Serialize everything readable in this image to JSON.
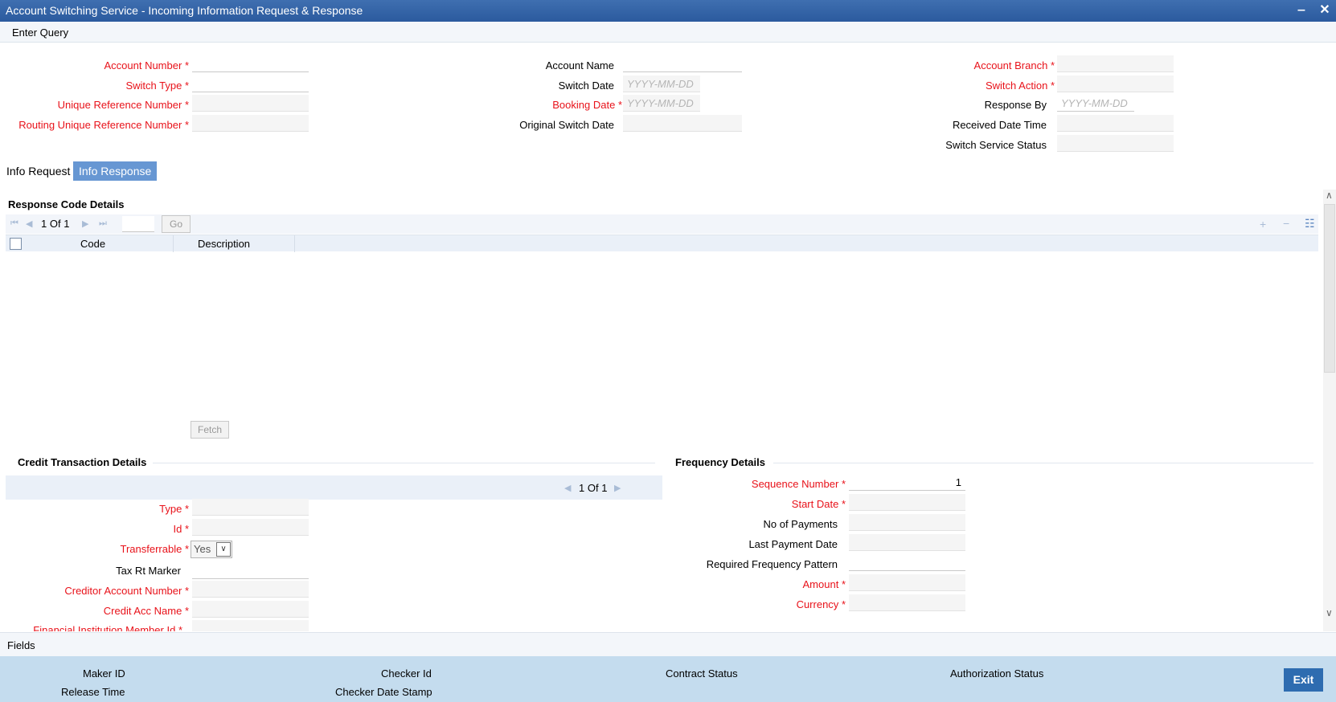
{
  "window": {
    "title": "Account Switching Service - Incoming Information Request & Response"
  },
  "menu": {
    "enter_query": "Enter Query"
  },
  "header_fields": {
    "account_number": {
      "label": "Account Number",
      "req": "*",
      "value": ""
    },
    "switch_type": {
      "label": "Switch Type",
      "req": "*",
      "value": ""
    },
    "unique_reference_number": {
      "label": "Unique Reference Number",
      "req": "*",
      "value": ""
    },
    "routing_unique_reference_number": {
      "label": "Routing Unique Reference Number",
      "req": "*",
      "value": ""
    },
    "account_name": {
      "label": "Account Name",
      "value": ""
    },
    "switch_date": {
      "label": "Switch Date",
      "placeholder": "YYYY-MM-DD"
    },
    "booking_date": {
      "label": "Booking Date",
      "req": "*",
      "placeholder": "YYYY-MM-DD"
    },
    "original_switch_date": {
      "label": "Original Switch Date",
      "value": ""
    },
    "account_branch": {
      "label": "Account Branch",
      "req": "*",
      "value": ""
    },
    "switch_action": {
      "label": "Switch Action",
      "req": "*",
      "value": ""
    },
    "response_by": {
      "label": "Response By",
      "placeholder": "YYYY-MM-DD"
    },
    "received_date_time": {
      "label": "Received Date Time",
      "value": ""
    },
    "switch_service_status": {
      "label": "Switch Service Status",
      "value": ""
    }
  },
  "tabs": [
    {
      "label": "Info Request",
      "active": false
    },
    {
      "label": "Info Response",
      "active": true
    }
  ],
  "response_code": {
    "title": "Response Code Details",
    "pager": {
      "current": "1",
      "of_label": "Of",
      "total": "1"
    },
    "go_label": "Go",
    "columns": {
      "code": "Code",
      "description": "Description"
    },
    "fetch_label": "Fetch"
  },
  "credit_transaction": {
    "title": "Credit Transaction Details",
    "pager": {
      "current": "1",
      "of_label": "Of",
      "total": "1"
    },
    "type": {
      "label": "Type",
      "req": "*",
      "value": ""
    },
    "id": {
      "label": "Id",
      "req": "*",
      "value": ""
    },
    "transferrable": {
      "label": "Transferrable",
      "req": "*",
      "value": "Yes"
    },
    "tax_rt_marker": {
      "label": "Tax Rt Marker",
      "value": ""
    },
    "creditor_account_number": {
      "label": "Creditor Account Number",
      "req": "*",
      "value": ""
    },
    "credit_acc_name": {
      "label": "Credit Acc Name",
      "req": "*",
      "value": ""
    },
    "financial_institution_member_id": {
      "label": "Financial Institution Member Id",
      "req": "*",
      "value": ""
    }
  },
  "frequency": {
    "title": "Frequency Details",
    "sequence_number": {
      "label": "Sequence Number",
      "req": "*",
      "value": "1"
    },
    "start_date": {
      "label": "Start Date",
      "req": "*",
      "value": ""
    },
    "no_of_payments": {
      "label": "No of Payments",
      "value": ""
    },
    "last_payment_date": {
      "label": "Last Payment Date",
      "value": ""
    },
    "required_frequency_pattern": {
      "label": "Required Frequency Pattern",
      "value": ""
    },
    "amount": {
      "label": "Amount",
      "req": "*",
      "value": ""
    },
    "currency": {
      "label": "Currency",
      "req": "*",
      "value": ""
    }
  },
  "fields_bar": {
    "label": "Fields"
  },
  "footer": {
    "maker_id": "Maker ID",
    "release_time": "Release Time",
    "checker_id": "Checker Id",
    "checker_date_stamp": "Checker Date Stamp",
    "contract_status": "Contract Status",
    "authorization_status": "Authorization Status",
    "exit_label": "Exit"
  },
  "icons": {
    "minimize": "minimize-icon",
    "close": "close-icon",
    "add_row": "plus-icon",
    "delete_row": "minus-icon",
    "columns": "list-icon"
  },
  "colors": {
    "titlebar": "#2b5a9e",
    "required": "#e8121a",
    "active_tab": "#6797d3",
    "footer": "#c4dcee",
    "exit_button": "#2e6cb0"
  }
}
